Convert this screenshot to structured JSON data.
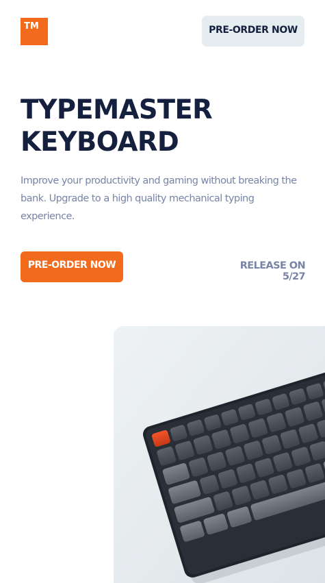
{
  "header": {
    "logo_text": "TM",
    "cta_label": "PRE-ORDER NOW"
  },
  "hero": {
    "title": "TYPEMASTER KEYBOARD",
    "description": "Improve your productivity and gaming without breaking the bank. Upgrade to a high quality mechanical typing experience.",
    "cta_label": "PRE-ORDER NOW",
    "release_text": "RELEASE ON 5/27",
    "image_name": "mechanical-keyboard-photo"
  },
  "colors": {
    "accent": "#f26a1b",
    "heading": "#14203d",
    "muted": "#7784a6",
    "nav_button_bg": "#e6edf1"
  }
}
